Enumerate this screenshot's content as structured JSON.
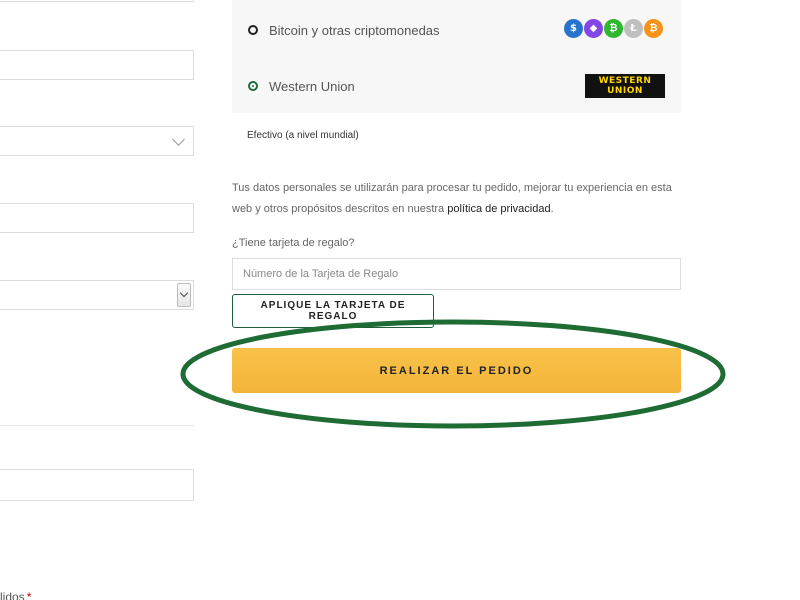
{
  "payment": {
    "crypto": {
      "label": "Bitcoin y otras criptomonedas",
      "icons": [
        {
          "name": "usdc-icon",
          "glyph": "$",
          "color": "#2775ca"
        },
        {
          "name": "ethereum-icon",
          "glyph": "◆",
          "color": "#8247e5"
        },
        {
          "name": "bitcoin-cash-icon",
          "glyph": "₿",
          "color": "#2fb82f"
        },
        {
          "name": "litecoin-icon",
          "glyph": "Ł",
          "color": "#bfbfbf"
        },
        {
          "name": "bitcoin-icon",
          "glyph": "₿",
          "color": "#f7931a"
        }
      ]
    },
    "western_union": {
      "label": "Western Union",
      "logo_text_1": "WESTERN",
      "logo_text_2": "UNION",
      "selected": true
    },
    "description": "Efectivo (a nivel mundial)"
  },
  "privacy": {
    "text": "Tus datos personales se utilizarán para procesar tu pedido, mejorar tu experiencia en esta web y otros propósitos descritos en nuestra ",
    "link": "política de privacidad",
    "end": "."
  },
  "gift_card": {
    "question": "¿Tiene tarjeta de regalo?",
    "placeholder": "Número de la Tarjeta de Regalo",
    "button": "APLIQUE LA TARJETA DE REGALO"
  },
  "order": {
    "button": "REALIZAR EL PEDIDO"
  },
  "left_form": {
    "partial_label": "lidos",
    "required_mark": "*"
  },
  "colors": {
    "accent_green": "#1f6b3a",
    "order_button": "#f6bb43",
    "highlight": "#1e6b34"
  }
}
